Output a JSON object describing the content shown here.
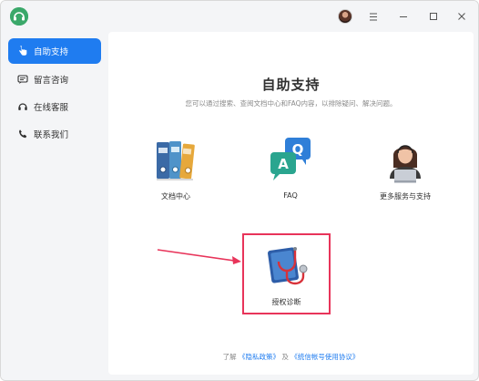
{
  "sidebar": {
    "items": [
      {
        "label": "自助支持",
        "icon": "hand-point-icon",
        "active": true
      },
      {
        "label": "留言咨询",
        "icon": "message-icon",
        "active": false
      },
      {
        "label": "在线客服",
        "icon": "headset-icon",
        "active": false
      },
      {
        "label": "联系我们",
        "icon": "phone-icon",
        "active": false
      }
    ]
  },
  "main": {
    "title": "自助支持",
    "subtitle": "您可以通过搜索、查阅文档中心和FAQ内容，以排除疑问、解决问题。",
    "cards": [
      {
        "label": "文档中心",
        "icon": "binders-icon"
      },
      {
        "label": "FAQ",
        "icon": "qa-bubbles-icon"
      },
      {
        "label": "更多服务与支持",
        "icon": "support-agent-icon"
      },
      {
        "label": "授权诊断",
        "icon": "stethoscope-icon"
      }
    ],
    "footer": {
      "prefix": "了解",
      "privacy_link": "《隐私政策》",
      "conjunction": "及",
      "terms_link": "《统信帐号使用协议》"
    }
  },
  "colors": {
    "accent": "#1f7cf0",
    "highlight_border": "#e8345a",
    "app_logo": "#3aa86a"
  }
}
